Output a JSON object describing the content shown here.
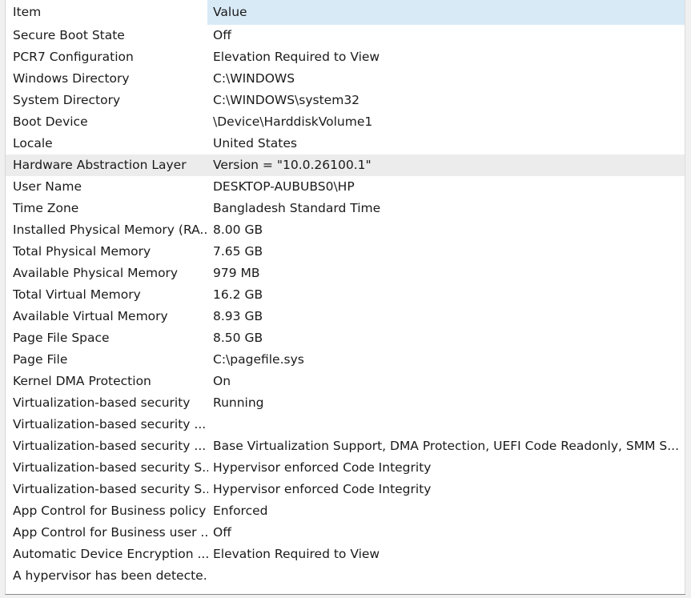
{
  "header": {
    "item": "Item",
    "value": "Value"
  },
  "rows": [
    {
      "item": "Secure Boot State",
      "value": "Off"
    },
    {
      "item": "PCR7 Configuration",
      "value": "Elevation Required to View"
    },
    {
      "item": "Windows Directory",
      "value": "C:\\WINDOWS"
    },
    {
      "item": "System Directory",
      "value": "C:\\WINDOWS\\system32"
    },
    {
      "item": "Boot Device",
      "value": "\\Device\\HarddiskVolume1"
    },
    {
      "item": "Locale",
      "value": "United States"
    },
    {
      "item": "Hardware Abstraction Layer",
      "value": "Version = \"10.0.26100.1\""
    },
    {
      "item": "User Name",
      "value": "DESKTOP-AUBUBS0\\HP"
    },
    {
      "item": "Time Zone",
      "value": "Bangladesh Standard Time"
    },
    {
      "item": "Installed Physical Memory (RA...",
      "value": "8.00 GB"
    },
    {
      "item": "Total Physical Memory",
      "value": "7.65 GB"
    },
    {
      "item": "Available Physical Memory",
      "value": "979 MB"
    },
    {
      "item": "Total Virtual Memory",
      "value": "16.2 GB"
    },
    {
      "item": "Available Virtual Memory",
      "value": "8.93 GB"
    },
    {
      "item": "Page File Space",
      "value": "8.50 GB"
    },
    {
      "item": "Page File",
      "value": "C:\\pagefile.sys"
    },
    {
      "item": "Kernel DMA Protection",
      "value": "On"
    },
    {
      "item": "Virtualization-based security",
      "value": "Running"
    },
    {
      "item": "Virtualization-based security ...",
      "value": ""
    },
    {
      "item": "Virtualization-based security ...",
      "value": "Base Virtualization Support, DMA Protection, UEFI Code Readonly, SMM S..."
    },
    {
      "item": "Virtualization-based security S...",
      "value": "Hypervisor enforced Code Integrity"
    },
    {
      "item": "Virtualization-based security S...",
      "value": "Hypervisor enforced Code Integrity"
    },
    {
      "item": "App Control for Business policy",
      "value": "Enforced"
    },
    {
      "item": "App Control for Business user ...",
      "value": "Off"
    },
    {
      "item": "Automatic Device Encryption ...",
      "value": "Elevation Required to View"
    },
    {
      "item": "A hypervisor has been detecte...",
      "value": ""
    }
  ]
}
